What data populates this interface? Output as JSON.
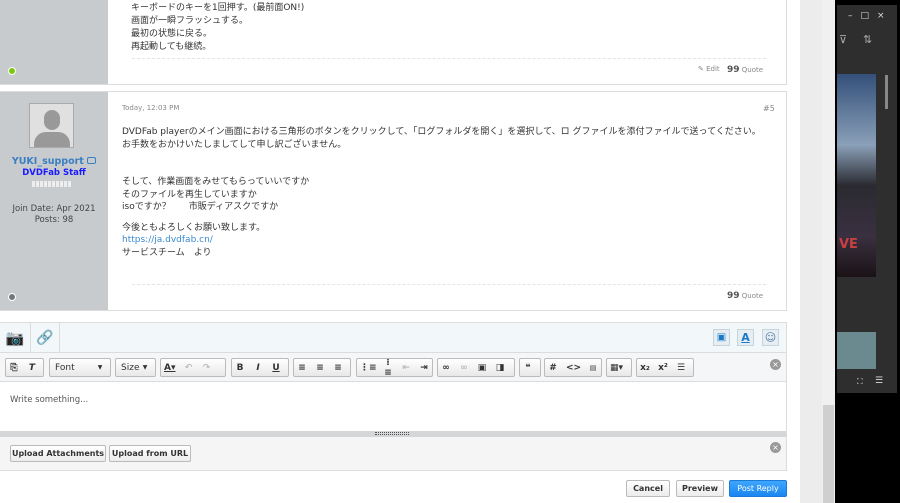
{
  "post_prev": {
    "lines": [
      "キーボードのキーを1回押す。(最前面ON!)",
      "画面が一瞬フラッシュする。",
      "最初の状態に戻る。",
      "再起動しても継続。"
    ],
    "edit": "Edit",
    "quote": "Quote"
  },
  "post5": {
    "date": "Today, 12:03 PM",
    "number": "#5",
    "username": "YUKI_support",
    "title": "DVDFab Staff",
    "join_date": "Join Date: Apr 2021",
    "posts": "Posts: 98",
    "lines": [
      "DVDFab playerのメイン画面における三角形のボタンをクリックして、「ログフォルダを開く」を選択して、ロ グファイルを添付ファイルで送ってください。",
      "お手数をおかけいたしましてして申し訳ございません。",
      "",
      "",
      "そして、作業画面をみせてもらっていいですか",
      "そのファイルを再生していますか",
      "isoですか？　　市販ディアスクですか",
      "",
      "今後ともよろしくお願い致します。"
    ],
    "link": "https://ja.dvdfab.cn/",
    "sign": "サービスチーム　より",
    "quote": "Quote"
  },
  "editor": {
    "font": "Font",
    "size": "Size",
    "placeholder": "Write something...",
    "upload_attachments": "Upload Attachments",
    "upload_url": "Upload from URL",
    "cancel": "Cancel",
    "preview": "Preview",
    "post_reply": "Post Reply"
  },
  "colors": {
    "accent": "#1a8cf0",
    "user": "#3a7fc1",
    "staff": "#1a1aff"
  }
}
